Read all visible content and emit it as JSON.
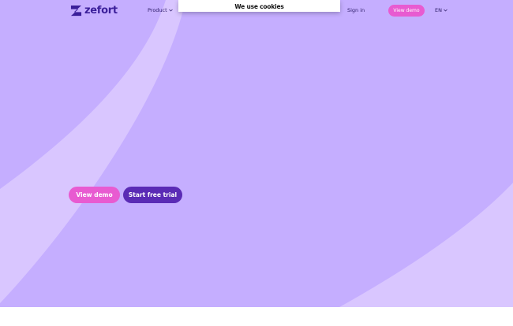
{
  "brand": {
    "name": "zefort",
    "logo_color": "#3b1f9a"
  },
  "nav": {
    "items": [
      {
        "label": "Product",
        "has_dropdown": true
      }
    ],
    "sign_in": "Sign in",
    "cta": "View demo",
    "language": "EN"
  },
  "cookie_banner": {
    "title": "We use cookies"
  },
  "hero": {
    "primary_button": "View demo",
    "secondary_button": "Start free trial"
  },
  "colors": {
    "hero_background": "#c5aeff",
    "hero_accent_shape": "#d9c6ff",
    "pink_button": "#e85bd1",
    "purple_button": "#5a2bb5",
    "nav_text": "#2a1a66"
  },
  "icons": {
    "dropdown": "chevron-down-icon",
    "logo": "zefort-z-icon"
  }
}
